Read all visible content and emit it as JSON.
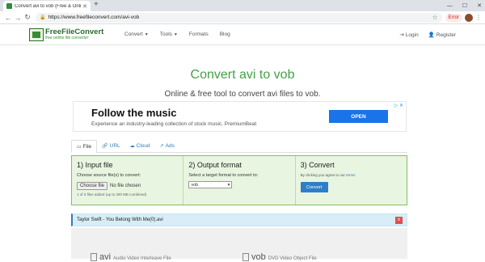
{
  "browser": {
    "tab_title": "Convert avi to vob (Free & Onli...",
    "url": "https://www.freefileconvert.com/avi-vob",
    "error_badge": "Error"
  },
  "site": {
    "logo_name": "FreeFileConvert",
    "logo_sub": "free online file converter",
    "nav": [
      "Convert",
      "Tools",
      "Formats",
      "Blog"
    ],
    "login": "Login",
    "register": "Register"
  },
  "hero": {
    "title": "Convert avi to vob",
    "subtitle": "Online & free tool to convert avi files to vob."
  },
  "ad": {
    "title": "Follow the music",
    "text": "Experience an industry-leading collection of stock music. PremiumBeat",
    "button": "OPEN"
  },
  "tabs": [
    "File",
    "URL",
    "Cloud",
    "Ads"
  ],
  "steps": {
    "s1": {
      "title": "1) Input file",
      "desc": "Choose source file(s) to convert:",
      "choose": "Choose file",
      "nofile": "No file chosen",
      "count_a": "1",
      "count_b": "5",
      "note_of": "of",
      "note": "files added (up to 300 MB combined)"
    },
    "s2": {
      "title": "2) Output format",
      "desc": "Select a target format to convert to:",
      "format": "vob"
    },
    "s3": {
      "title": "3) Convert",
      "agree": "By clicking you agree to our",
      "terms": "terms",
      "button": "Convert"
    }
  },
  "file_row": {
    "name": "Taylor Swift - You Belong With Me(0).avi",
    "remove": "x"
  },
  "formats": [
    {
      "ext": "avi",
      "name": "Audio Video Interleave File"
    },
    {
      "ext": "vob",
      "name": "DVD Video Object File"
    }
  ]
}
